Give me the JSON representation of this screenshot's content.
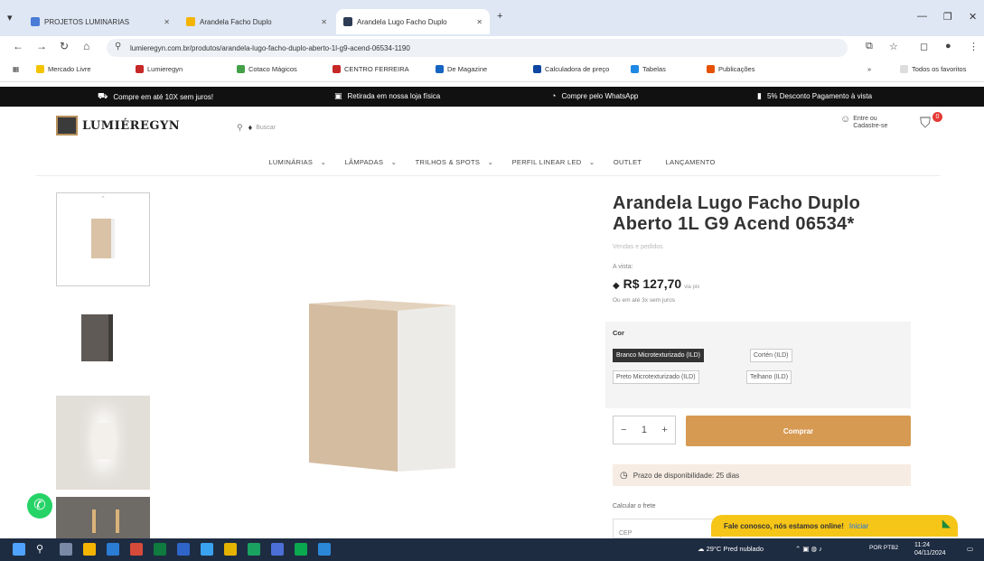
{
  "browser": {
    "tabs": [
      {
        "title": "PROJETOS LUMINARIAS"
      },
      {
        "title": "Arandela Facho Duplo"
      },
      {
        "title": "Arandela Lugo Facho Duplo"
      }
    ],
    "url": "lumieregyn.com.br/produtos/arandela-lugo-facho-duplo-aberto-1l-g9-acend-06534-1190",
    "bookmarks": [
      {
        "label": "Mercado Livre"
      },
      {
        "label": "Lumieregyn"
      },
      {
        "label": "Cotaco Mágicos"
      },
      {
        "label": "CENTRO FERREIRA"
      },
      {
        "label": "De Magazine"
      },
      {
        "label": "Calculadora de preço"
      },
      {
        "label": "Tabelas"
      },
      {
        "label": "Publicações"
      }
    ],
    "all_bookmarks": "Todos os favoritos"
  },
  "promo": {
    "items": [
      {
        "icon": "truck-icon",
        "text": "Compre em até 10X sem juros!"
      },
      {
        "icon": "store-icon",
        "text": "Retirada em nossa loja física"
      },
      {
        "icon": "whatsapp-icon",
        "text": "Compre pelo WhatsApp"
      },
      {
        "icon": "card-icon",
        "text": "5% Desconto Pagamento à vista"
      }
    ]
  },
  "header": {
    "logo_text": "LUMIÉREGYN",
    "search_placeholder": "Buscar",
    "account_text": "Entre ou Cadastre-se",
    "cart_count": "0"
  },
  "menu": {
    "items": [
      "LUMINÁRIAS",
      "LÂMPADAS",
      "TRILHOS & SPOTS",
      "PERFIL LINEAR LED",
      "OUTLET",
      "LANÇAMENTO"
    ]
  },
  "product": {
    "title": "Arandela Lugo Facho Duplo Aberto 1L G9 Acend 06534*",
    "subtitle": "Vendas e pedidos",
    "price_label": "A vista:",
    "price": "R$ 127,70",
    "price_suffix": "via pix",
    "installments": "Ou em até 3x sem juros",
    "options_label": "Cor",
    "options": [
      {
        "label": "Branco Microtexturizado (ILD)",
        "selected": true
      },
      {
        "label": "Cortén (ILD)",
        "selected": false
      },
      {
        "label": "Preto Microtexturizado (ILD)",
        "selected": false
      },
      {
        "label": "Telhano (ILD)",
        "selected": false
      }
    ],
    "quantity": "1",
    "buy_label": "Comprar",
    "stock_text": "Prazo de disponibilidade: 25 dias",
    "freight_label": "Calcular o frete",
    "freight_placeholder": "CEP"
  },
  "chat": {
    "text": "Fale conosco, nós estamos online!",
    "link": "Iniciar"
  },
  "taskbar": {
    "weather": "29°C Pred nublado",
    "time": "11:24",
    "date": "04/11/2024",
    "lang": "POR PTB2"
  },
  "colors": {
    "accent": "#d79a52",
    "promo_bg": "#111111",
    "chat_bg": "#f5c518"
  }
}
